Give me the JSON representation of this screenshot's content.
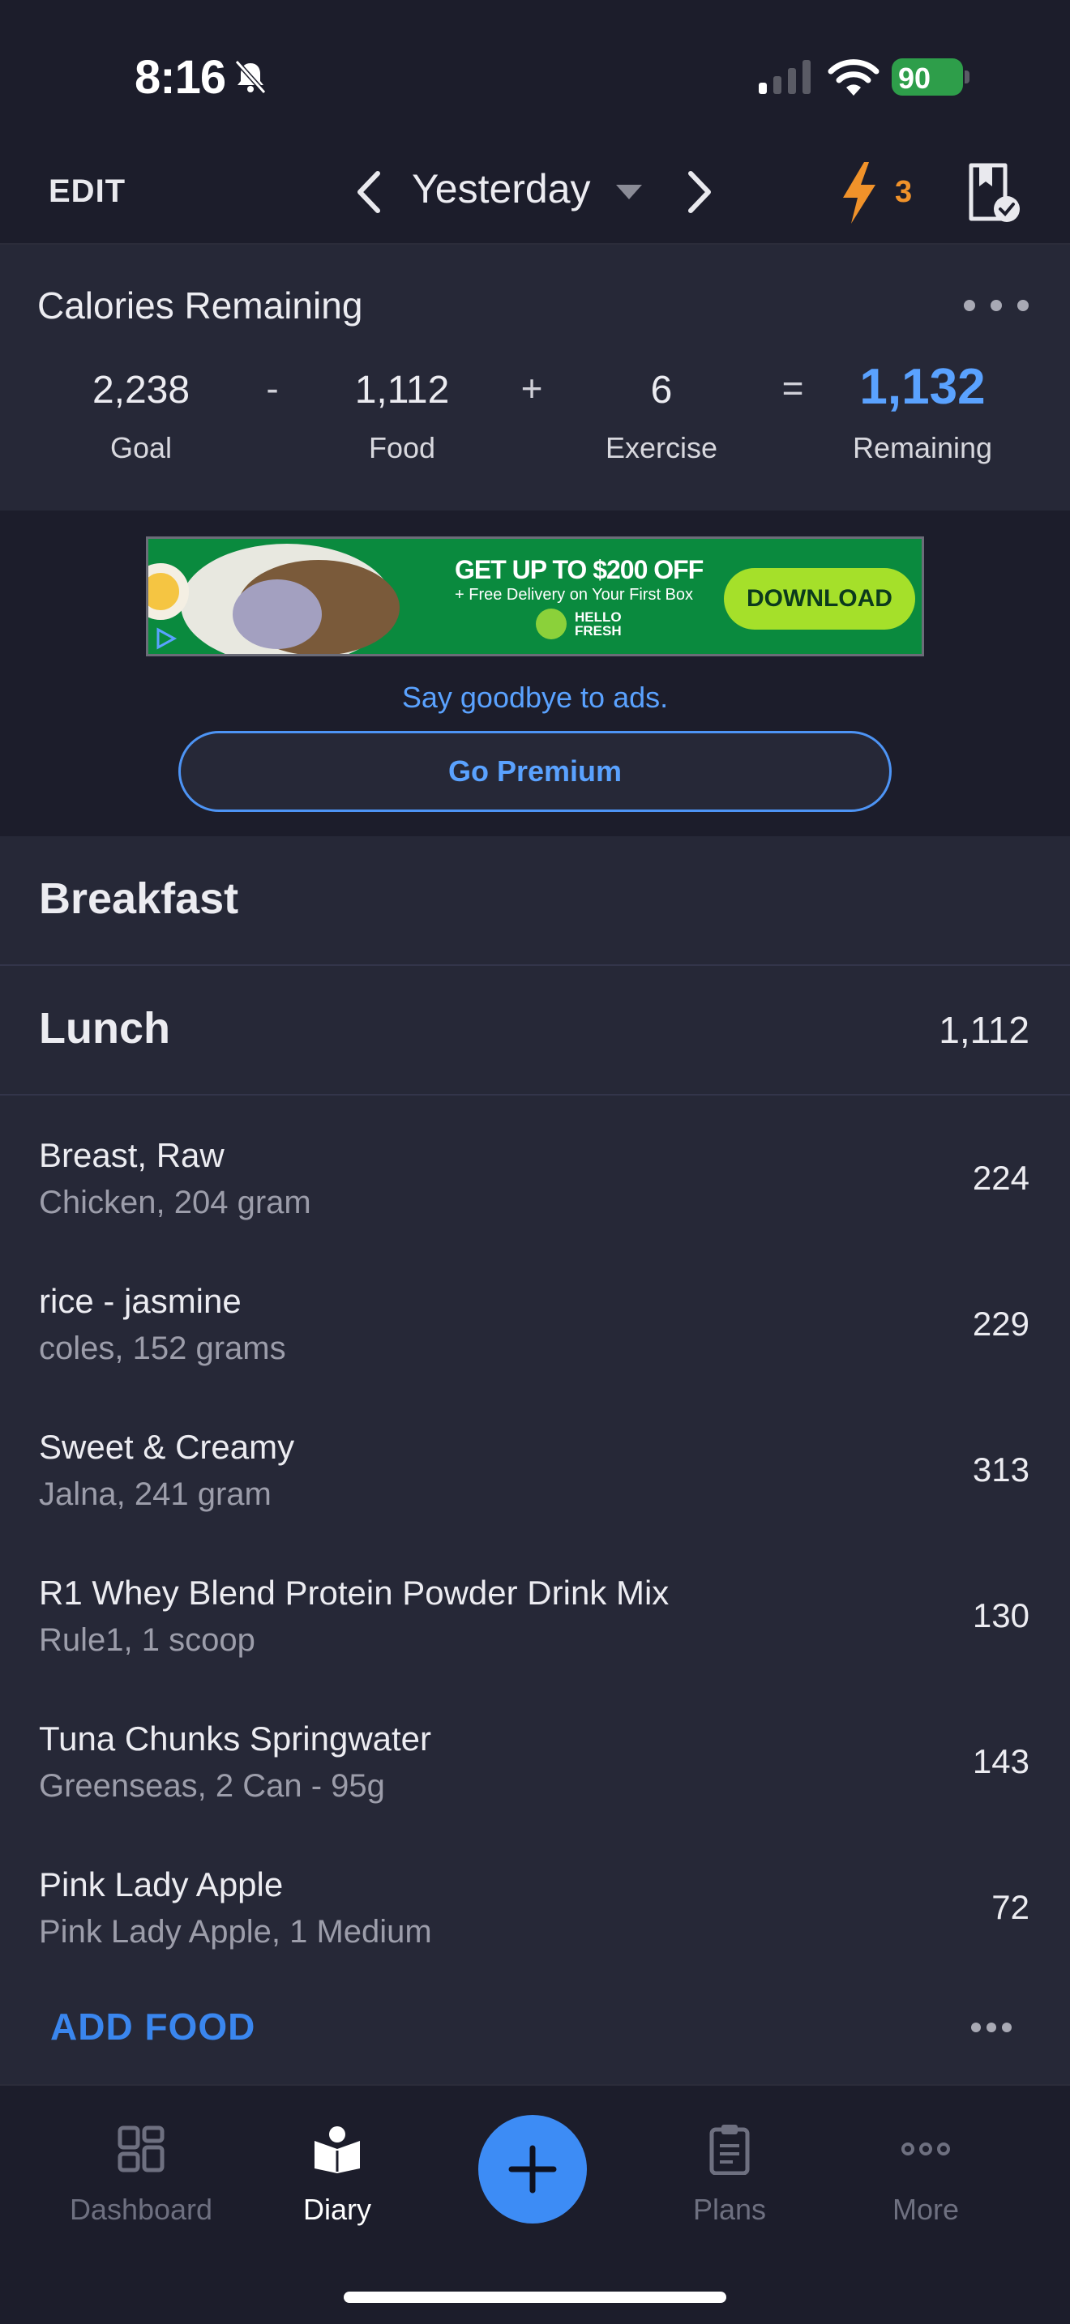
{
  "status_bar": {
    "time": "8:16",
    "battery": "90"
  },
  "nav": {
    "edit_label": "EDIT",
    "date_label": "Yesterday",
    "streak_count": "3"
  },
  "calories": {
    "title": "Calories Remaining",
    "goal_value": "2,238",
    "goal_label": "Goal",
    "op_minus": "-",
    "food_value": "1,112",
    "food_label": "Food",
    "op_plus": "+",
    "exercise_value": "6",
    "exercise_label": "Exercise",
    "op_equals": "=",
    "remaining_value": "1,132",
    "remaining_label": "Remaining"
  },
  "ad": {
    "headline": "GET UP TO $200 OFF",
    "subline": "+ Free Delivery on Your First Box",
    "brand": "HELLO FRESH",
    "cta": "DOWNLOAD",
    "goodbye_text": "Say goodbye to ads.",
    "premium_label": "Go Premium"
  },
  "meals": {
    "breakfast": {
      "name": "Breakfast"
    },
    "lunch": {
      "name": "Lunch",
      "total": "1,112",
      "items": [
        {
          "name": "Breast, Raw",
          "detail": "Chicken, 204 gram",
          "calories": "224"
        },
        {
          "name": "rice - jasmine",
          "detail": "coles, 152 grams",
          "calories": "229"
        },
        {
          "name": "Sweet & Creamy",
          "detail": "Jalna, 241 gram",
          "calories": "313"
        },
        {
          "name": "R1 Whey Blend Protein Powder Drink Mix",
          "detail": "Rule1, 1 scoop",
          "calories": "130"
        },
        {
          "name": "Tuna Chunks Springwater",
          "detail": "Greenseas, 2 Can - 95g",
          "calories": "143"
        },
        {
          "name": "Pink Lady Apple",
          "detail": "Pink Lady Apple, 1 Medium",
          "calories": "72"
        }
      ],
      "add_food_label": "ADD FOOD"
    }
  },
  "tabbar": {
    "tabs": [
      {
        "label": "Dashboard",
        "icon": "grid-icon",
        "active": false
      },
      {
        "label": "Diary",
        "icon": "book-icon",
        "active": true
      },
      {
        "label": "Plans",
        "icon": "clipboard-icon",
        "active": false
      },
      {
        "label": "More",
        "icon": "more-dots-icon",
        "active": false
      }
    ]
  },
  "colors": {
    "background": "#1c1d2b",
    "panel": "#262837",
    "accent_blue": "#5aa2ff",
    "streak_orange": "#f0922a",
    "battery_green": "#2e9e4a"
  }
}
